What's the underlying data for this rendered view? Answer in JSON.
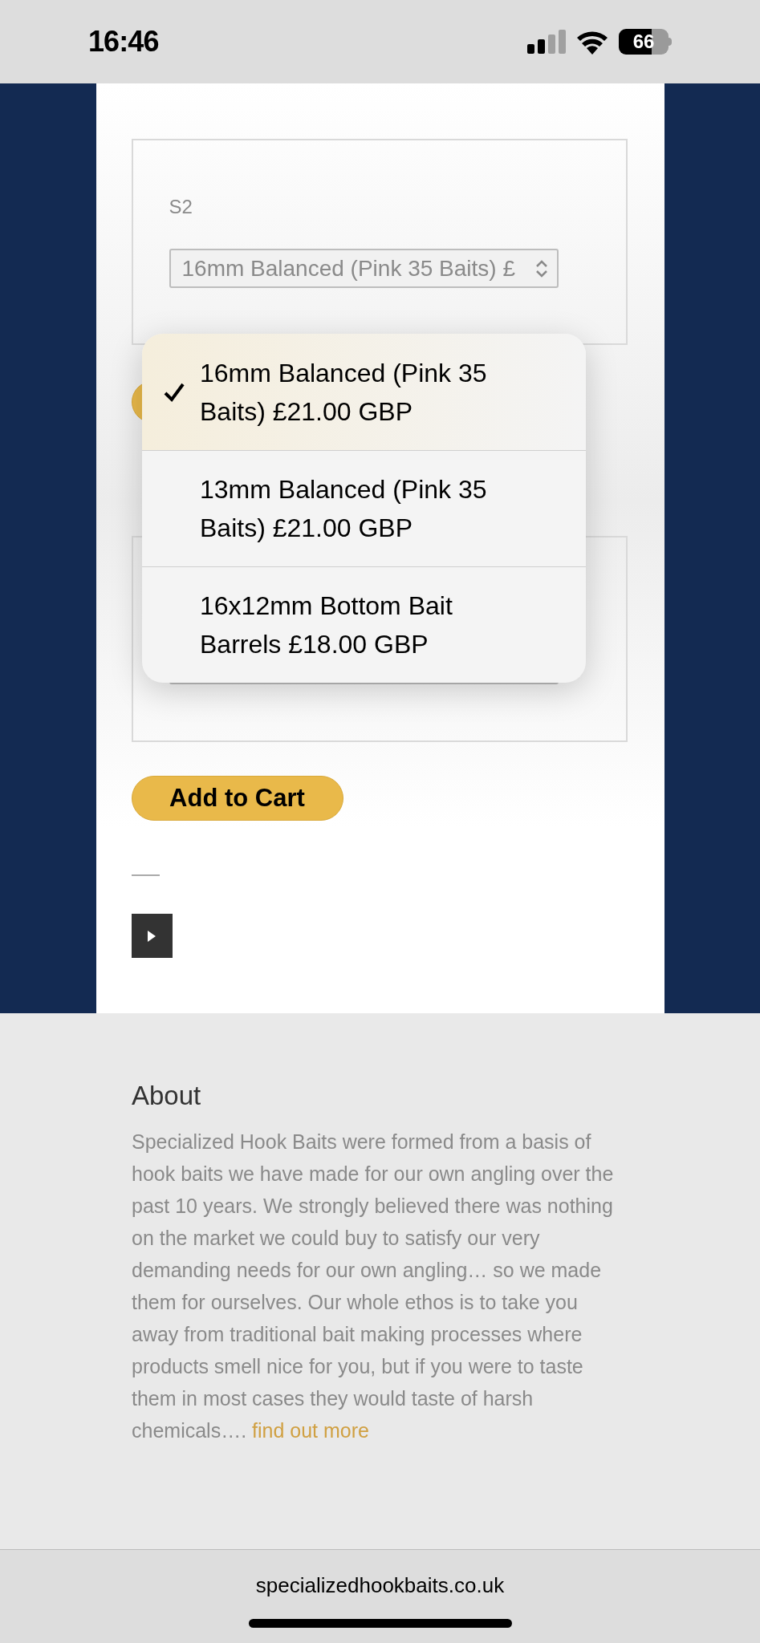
{
  "status_bar": {
    "time": "16:46",
    "battery": "66"
  },
  "product_form": {
    "option_label": "S2",
    "select_value": "16mm Balanced (Pink 35 Baits) £"
  },
  "dropdown": {
    "options": [
      {
        "label": "16mm Balanced (Pink 35 Baits) £21.00 GBP",
        "selected": true
      },
      {
        "label": "13mm Balanced (Pink 35 Baits) £21.00 GBP",
        "selected": false
      },
      {
        "label": "16x12mm Bottom Bait Barrels £18.00 GBP",
        "selected": false
      }
    ]
  },
  "add_to_cart": "Add to Cart",
  "about": {
    "heading": "About",
    "text": "Specialized Hook Baits were formed from a basis of hook baits we have made for our own angling over the past 10 years. We strongly believed there was nothing on the market we could buy to satisfy our very demanding needs for our own angling… so we made them for ourselves. Our whole ethos is to take you away from traditional bait making processes where products smell nice for you, but if you were to taste them in most cases they would taste of harsh chemicals….",
    "link": "find out more"
  },
  "browser": {
    "url": "specializedhookbaits.co.uk"
  }
}
